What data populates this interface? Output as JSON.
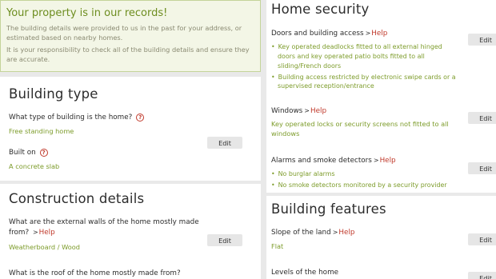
{
  "notice": {
    "title": "Your property is in our records!",
    "para1": "The building details were provided to us in the past for your address, or estimated based on nearby homes.",
    "para2": "It is your responsibility to check all of the building details and ensure they are accurate."
  },
  "building_type": {
    "title": "Building type",
    "q1": "What type of building is the home?",
    "a1": "Free standing home",
    "q2": "Built on",
    "a2": "A concrete slab",
    "edit": "Edit"
  },
  "construction": {
    "title": "Construction details",
    "q1": "What are the external walls of the home mostly made from?",
    "a1": "Weatherboard / Wood",
    "q2": "What is the roof of the home mostly made from?",
    "edit": "Edit",
    "help": "Help"
  },
  "security": {
    "title": "Home security",
    "doors_q": "Doors and building access",
    "doors_items": [
      "Key operated deadlocks fitted to all external hinged doors and key operated patio bolts fitted to all sliding/French doors",
      "Building access restricted by electronic swipe cards or a supervised reception/entrance"
    ],
    "windows_q": "Windows",
    "windows_a": "Key operated locks or security screens not fitted to all windows",
    "alarms_q": "Alarms and smoke detectors",
    "alarms_items": [
      "No burglar alarms",
      "No smoke detectors monitored by a security provider"
    ],
    "help": "Help",
    "edit": "Edit"
  },
  "features": {
    "title": "Building features",
    "slope_q": "Slope of the land",
    "slope_a": "Flat",
    "levels_q": "Levels of the home",
    "help": "Help",
    "edit": "Edit"
  },
  "colors": {
    "accent_green": "#7d9c2b",
    "help_red": "#c0392b"
  }
}
